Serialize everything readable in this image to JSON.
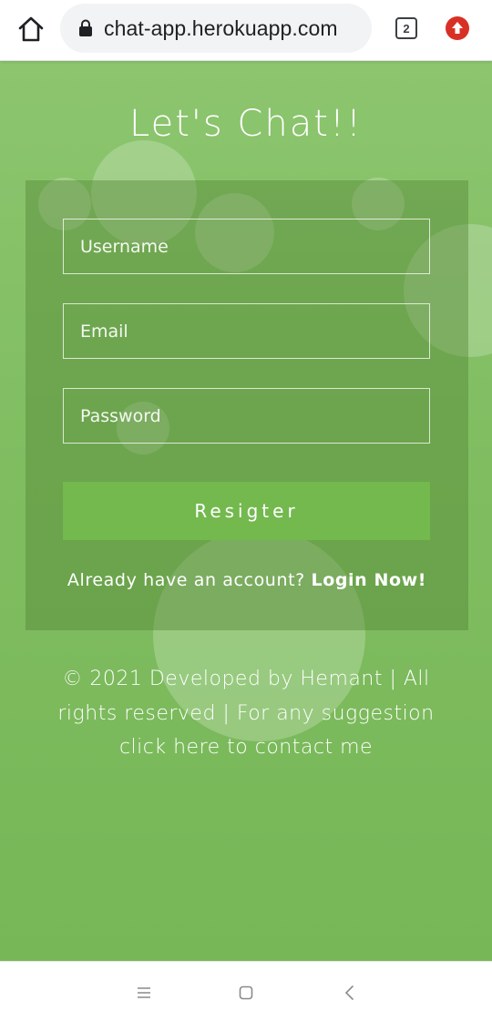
{
  "browser": {
    "url": "chat-app.herokuapp.com",
    "tab_count": "2",
    "icons": {
      "home": "home-icon",
      "lock": "lock-icon",
      "tabs": "tabs-count-icon",
      "update": "update-arrow-icon"
    }
  },
  "page": {
    "title": "Let's Chat!!",
    "form": {
      "username_placeholder": "Username",
      "email_placeholder": "Email",
      "password_placeholder": "Password",
      "register_label": "Resigter",
      "account_prompt": "Already have an account? ",
      "login_link": "Login Now!"
    },
    "footer": {
      "text": "© 2021 Developed by Hemant | All rights reserved | For any suggestion ",
      "contact_link": "click here to contact me"
    }
  },
  "nav_bar": {
    "icons": [
      "menu-lines-icon",
      "home-square-icon",
      "back-chevron-icon"
    ]
  },
  "colors": {
    "accent_green": "#73b94e",
    "background_green": "#80bd61",
    "update_red": "#d93025"
  }
}
